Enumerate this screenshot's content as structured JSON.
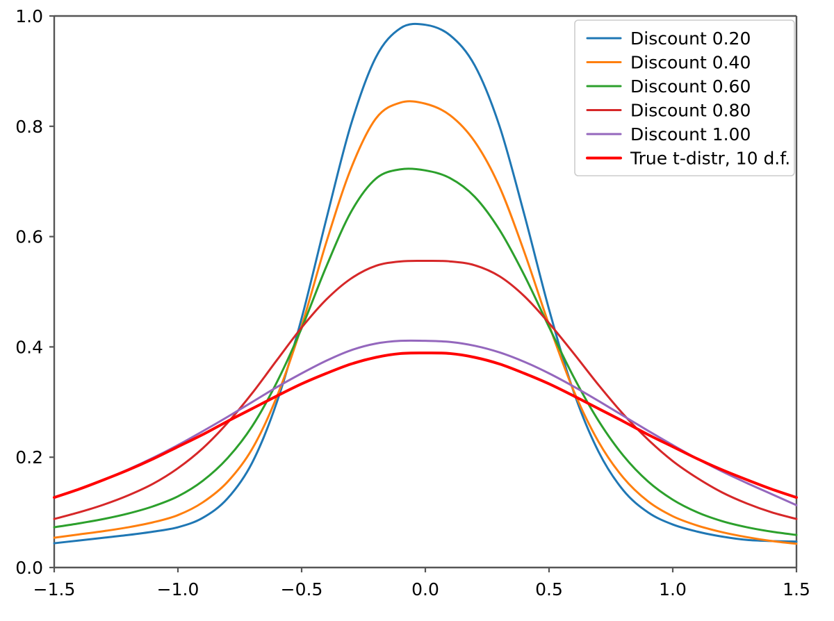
{
  "chart_data": {
    "type": "line",
    "title": "",
    "xlabel": "",
    "ylabel": "",
    "xlim": [
      -1.5,
      1.5
    ],
    "ylim": [
      0.0,
      1.0
    ],
    "xticks": [
      -1.5,
      -1.0,
      -0.5,
      0.0,
      0.5,
      1.0,
      1.5
    ],
    "xticklabels": [
      "−1.5",
      "−1.0",
      "−0.5",
      "0.0",
      "0.5",
      "1.0",
      "1.5"
    ],
    "yticks": [
      0.0,
      0.2,
      0.4,
      0.6,
      0.8,
      1.0
    ],
    "yticklabels": [
      "0.0",
      "0.2",
      "0.4",
      "0.6",
      "0.8",
      "1.0"
    ],
    "grid": false,
    "legend_position": "upper right",
    "x": [
      -1.5,
      -1.4,
      -1.3,
      -1.2,
      -1.1,
      -1.0,
      -0.9,
      -0.8,
      -0.7,
      -0.6,
      -0.5,
      -0.4,
      -0.3,
      -0.2,
      -0.1,
      0.0,
      0.1,
      0.2,
      0.3,
      0.4,
      0.5,
      0.6,
      0.7,
      0.8,
      0.9,
      1.0,
      1.1,
      1.2,
      1.3,
      1.4,
      1.5
    ],
    "series": [
      {
        "name": "Discount 0.20",
        "color": "#1f77b4",
        "linewidth": 3,
        "values": [
          0.044,
          0.049,
          0.054,
          0.059,
          0.065,
          0.073,
          0.09,
          0.125,
          0.19,
          0.3,
          0.452,
          0.632,
          0.804,
          0.925,
          0.978,
          0.984,
          0.965,
          0.91,
          0.8,
          0.64,
          0.468,
          0.318,
          0.21,
          0.14,
          0.1,
          0.078,
          0.065,
          0.056,
          0.05,
          0.048,
          0.047
        ]
      },
      {
        "name": "Discount 0.40",
        "color": "#ff7f0e",
        "linewidth": 3,
        "values": [
          0.054,
          0.06,
          0.066,
          0.073,
          0.082,
          0.095,
          0.118,
          0.155,
          0.215,
          0.31,
          0.438,
          0.59,
          0.724,
          0.814,
          0.843,
          0.841,
          0.82,
          0.772,
          0.69,
          0.572,
          0.44,
          0.32,
          0.228,
          0.163,
          0.12,
          0.093,
          0.076,
          0.064,
          0.055,
          0.048,
          0.043
        ]
      },
      {
        "name": "Discount 0.60",
        "color": "#2ca02c",
        "linewidth": 3,
        "values": [
          0.073,
          0.08,
          0.088,
          0.098,
          0.111,
          0.129,
          0.157,
          0.198,
          0.256,
          0.336,
          0.434,
          0.546,
          0.645,
          0.705,
          0.722,
          0.72,
          0.706,
          0.672,
          0.612,
          0.53,
          0.436,
          0.345,
          0.266,
          0.203,
          0.156,
          0.123,
          0.1,
          0.084,
          0.073,
          0.065,
          0.059
        ]
      },
      {
        "name": "Discount 0.80",
        "color": "#d62728",
        "linewidth": 3,
        "values": [
          0.088,
          0.1,
          0.114,
          0.131,
          0.152,
          0.18,
          0.216,
          0.262,
          0.316,
          0.376,
          0.435,
          0.486,
          0.524,
          0.547,
          0.555,
          0.556,
          0.555,
          0.548,
          0.528,
          0.492,
          0.443,
          0.388,
          0.331,
          0.278,
          0.232,
          0.193,
          0.162,
          0.136,
          0.116,
          0.1,
          0.088
        ]
      },
      {
        "name": "Discount 1.00",
        "color": "#9467bd",
        "linewidth": 3,
        "values": [
          0.127,
          0.142,
          0.159,
          0.178,
          0.199,
          0.222,
          0.247,
          0.273,
          0.3,
          0.327,
          0.352,
          0.375,
          0.394,
          0.406,
          0.411,
          0.411,
          0.409,
          0.402,
          0.39,
          0.373,
          0.352,
          0.328,
          0.302,
          0.275,
          0.248,
          0.222,
          0.197,
          0.174,
          0.153,
          0.133,
          0.113
        ]
      },
      {
        "name": "True t-distr, 10 d.f.",
        "color": "#ff0000",
        "linewidth": 4,
        "values": [
          0.127,
          0.142,
          0.159,
          0.177,
          0.197,
          0.219,
          0.241,
          0.265,
          0.288,
          0.311,
          0.333,
          0.352,
          0.369,
          0.381,
          0.388,
          0.389,
          0.388,
          0.381,
          0.369,
          0.352,
          0.333,
          0.311,
          0.288,
          0.265,
          0.241,
          0.219,
          0.197,
          0.177,
          0.159,
          0.142,
          0.127
        ]
      }
    ]
  },
  "axes": {
    "spine_color": "#555555",
    "background": "#ffffff",
    "tick_color": "#555555"
  },
  "legend": {
    "border_color": "#cccccc",
    "background": "#ffffff",
    "entries": [
      {
        "label": "Discount 0.20",
        "color": "#1f77b4"
      },
      {
        "label": "Discount 0.40",
        "color": "#ff7f0e"
      },
      {
        "label": "Discount 0.60",
        "color": "#2ca02c"
      },
      {
        "label": "Discount 0.80",
        "color": "#d62728"
      },
      {
        "label": "Discount 1.00",
        "color": "#9467bd"
      },
      {
        "label": "True t-distr, 10 d.f.",
        "color": "#ff0000"
      }
    ]
  }
}
